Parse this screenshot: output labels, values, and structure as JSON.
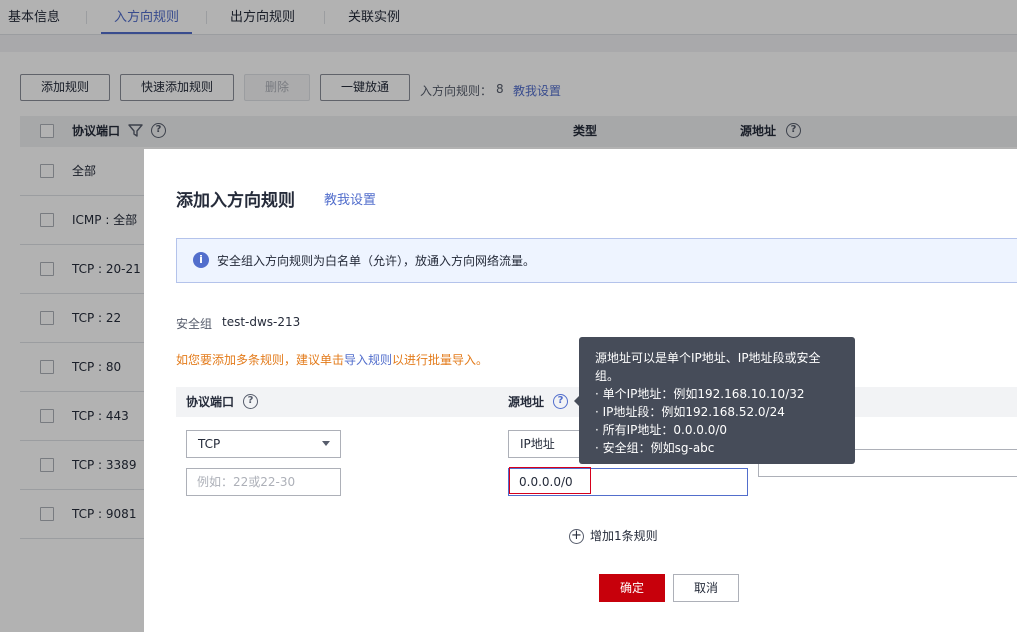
{
  "tabs": [
    {
      "label": "基本信息"
    },
    {
      "label": "入方向规则"
    },
    {
      "label": "出方向规则"
    },
    {
      "label": "关联实例"
    }
  ],
  "toolbar": {
    "add_rule": "添加规则",
    "quick_add": "快速添加规则",
    "delete": "删除",
    "one_click": "一键放通",
    "count_label": "入方向规则：",
    "count": "8",
    "help_link": "教我设置"
  },
  "table": {
    "headers": {
      "protocol_port": "协议端口",
      "type": "类型",
      "source": "源地址"
    },
    "rows": [
      {
        "label": "全部"
      },
      {
        "label": "ICMP : 全部"
      },
      {
        "label": "TCP : 20-21"
      },
      {
        "label": "TCP : 22"
      },
      {
        "label": "TCP : 80"
      },
      {
        "label": "TCP : 443"
      },
      {
        "label": "TCP : 3389"
      },
      {
        "label": "TCP : 9081"
      }
    ]
  },
  "dialog": {
    "title": "添加入方向规则",
    "help_link": "教我设置",
    "info_text": "安全组入方向规则为白名单（允许），放通入方向网络流量。",
    "sg_label": "安全组",
    "sg_value": "test-dws-213",
    "tip_prefix": "如您要添加多条规则，建议单击",
    "tip_link": "导入规则",
    "tip_suffix": "以进行批量导入。",
    "headers": {
      "protocol_port": "协议端口",
      "source": "源地址"
    },
    "protocol_value": "TCP",
    "port_placeholder": "例如：22或22-30",
    "source_type_value": "IP地址",
    "source_value": "0.0.0.0/0",
    "add_rule": "增加1条规则",
    "ok": "确定",
    "cancel": "取消"
  },
  "tooltip": {
    "lines": [
      "源地址可以是单个IP地址、IP地址段或安全组。",
      "· 单个IP地址：例如192.168.10.10/32",
      "· IP地址段：例如192.168.52.0/24",
      "· 所有IP地址：0.0.0.0/0",
      "· 安全组：例如sg-abc"
    ]
  },
  "colors": {
    "accent": "#526ecc",
    "primary_button": "#c7000b",
    "warning_text": "#e37b1b",
    "tooltip_bg": "#464c59"
  }
}
